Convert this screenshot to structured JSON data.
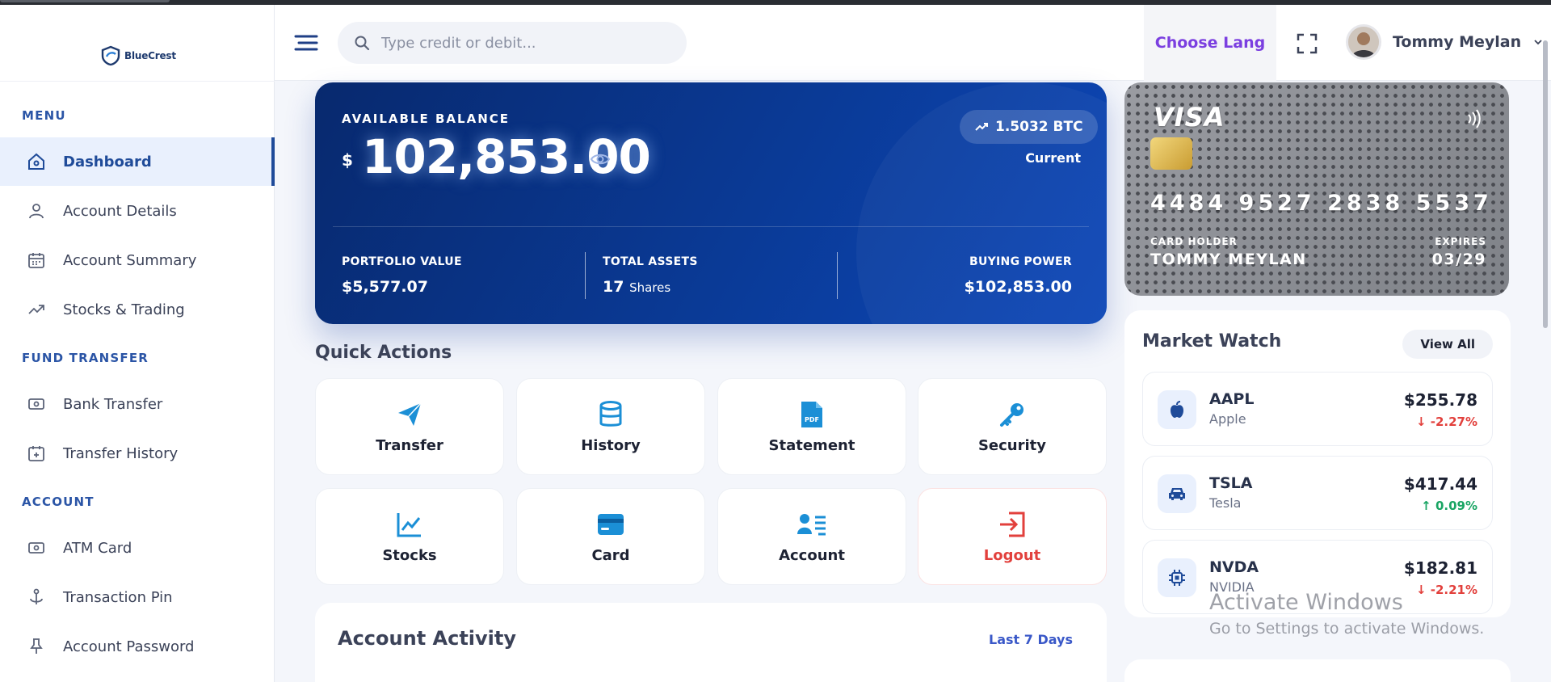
{
  "brand": {
    "name": "BlueCrest"
  },
  "search": {
    "placeholder": "Type credit or debit..."
  },
  "header": {
    "language_label": "Choose Lang",
    "user_name": "Tommy Meylan"
  },
  "sidebar": {
    "sections": {
      "menu": "MENU",
      "fund_transfer": "FUND TRANSFER",
      "account": "ACCOUNT"
    },
    "items": [
      {
        "label": "Dashboard",
        "icon": "home-icon",
        "active": true
      },
      {
        "label": "Account Details",
        "icon": "user-icon"
      },
      {
        "label": "Account Summary",
        "icon": "calendar-icon"
      },
      {
        "label": "Stocks & Trading",
        "icon": "trending-icon"
      },
      {
        "label": "Bank Transfer",
        "icon": "money-icon"
      },
      {
        "label": "Transfer History",
        "icon": "calendar-plus-icon"
      },
      {
        "label": "ATM Card",
        "icon": "card-icon"
      },
      {
        "label": "Transaction Pin",
        "icon": "anchor-icon"
      },
      {
        "label": "Account Password",
        "icon": "pin-icon"
      }
    ]
  },
  "balance": {
    "label": "AVAILABLE BALANCE",
    "currency": "$",
    "amount": "102,853.00",
    "btc": "1.5032 BTC",
    "status": "Current",
    "portfolio_label": "PORTFOLIO VALUE",
    "portfolio_value": "$5,577.07",
    "assets_label": "TOTAL ASSETS",
    "assets_value": "17",
    "assets_unit": "Shares",
    "buying_label": "BUYING POWER",
    "buying_value": "$102,853.00"
  },
  "quick_actions": {
    "title": "Quick Actions",
    "items": [
      {
        "label": "Transfer",
        "icon": "paper-plane-icon"
      },
      {
        "label": "History",
        "icon": "database-icon"
      },
      {
        "label": "Statement",
        "icon": "pdf-icon"
      },
      {
        "label": "Security",
        "icon": "key-icon"
      },
      {
        "label": "Stocks",
        "icon": "chart-line-icon"
      },
      {
        "label": "Card",
        "icon": "credit-card-icon"
      },
      {
        "label": "Account",
        "icon": "id-card-icon"
      },
      {
        "label": "Logout",
        "icon": "logout-icon"
      }
    ]
  },
  "activity": {
    "title": "Account Activity",
    "range": "Last 7 Days"
  },
  "card": {
    "brand": "VISA",
    "number": "4484 9527 2838 5537",
    "holder_label": "CARD HOLDER",
    "holder": "TOMMY MEYLAN",
    "expires_label": "EXPIRES",
    "expires": "03/29"
  },
  "market": {
    "title": "Market Watch",
    "view_all": "View All",
    "stocks": [
      {
        "symbol": "AAPL",
        "name": "Apple",
        "price": "$255.78",
        "change": "↓ -2.27%",
        "direction": "down",
        "icon": "apple-icon"
      },
      {
        "symbol": "TSLA",
        "name": "Tesla",
        "price": "$417.44",
        "change": "↑ 0.09%",
        "direction": "up",
        "icon": "car-icon"
      },
      {
        "symbol": "NVDA",
        "name": "NVIDIA",
        "price": "$182.81",
        "change": "↓ -2.21%",
        "direction": "down",
        "icon": "chip-icon"
      }
    ]
  },
  "watermark": {
    "title": "Activate Windows",
    "subtitle": "Go to Settings to activate Windows."
  },
  "colors": {
    "primary": "#1f4b99",
    "accent_purple": "#7b3fe0",
    "danger": "#e2403c",
    "success": "#1aa564",
    "icon_blue": "#1b8fd6"
  }
}
